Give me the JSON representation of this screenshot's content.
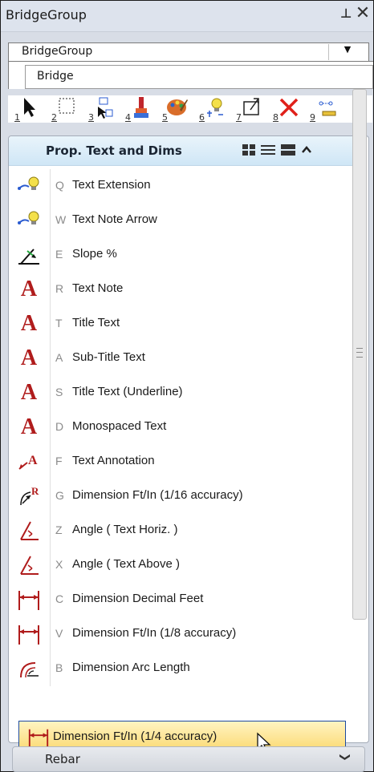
{
  "window": {
    "title": "BridgeGroup"
  },
  "group_select": {
    "value": "BridgeGroup"
  },
  "subtab": {
    "label": "Bridge"
  },
  "toolbar": {
    "tools": [
      {
        "num": "1",
        "icon": "select-arrow-icon"
      },
      {
        "num": "2",
        "icon": "selection-box-icon"
      },
      {
        "num": "3",
        "icon": "element-selection-icon"
      },
      {
        "num": "4",
        "icon": "paint-brush-icon"
      },
      {
        "num": "5",
        "icon": "palette-icon"
      },
      {
        "num": "6",
        "icon": "highlight-bulb-icon"
      },
      {
        "num": "7",
        "icon": "fit-view-icon"
      },
      {
        "num": "8",
        "icon": "delete-x-icon"
      },
      {
        "num": "9",
        "icon": "measure-icon"
      }
    ]
  },
  "panel": {
    "title": "Prop. Text and Dims",
    "items": [
      {
        "key": "Q",
        "label": "Text Extension",
        "icon": "bulb-arrow-icon"
      },
      {
        "key": "W",
        "label": "Text Note Arrow",
        "icon": "bulb-arrow-icon"
      },
      {
        "key": "E",
        "label": "Slope %",
        "icon": "slope-icon"
      },
      {
        "key": "R",
        "label": "Text Note",
        "icon": "letter-a-icon"
      },
      {
        "key": "T",
        "label": "Title Text",
        "icon": "letter-a-icon"
      },
      {
        "key": "A",
        "label": "Sub-Title Text",
        "icon": "letter-a-icon"
      },
      {
        "key": "S",
        "label": "Title Text (Underline)",
        "icon": "letter-a-icon"
      },
      {
        "key": "D",
        "label": "Monospaced Text",
        "icon": "letter-a-icon"
      },
      {
        "key": "F",
        "label": "Text Annotation",
        "icon": "annotation-icon"
      },
      {
        "key": "G",
        "label": "Dimension Ft/In (1/16 accuracy)",
        "icon": "radius-dim-icon"
      },
      {
        "key": "Z",
        "label": "Angle ( Text Horiz. )",
        "icon": "angle-icon"
      },
      {
        "key": "X",
        "label": "Angle ( Text Above )",
        "icon": "angle-icon"
      },
      {
        "key": "C",
        "label": "Dimension Decimal Feet",
        "icon": "linear-dim-icon"
      },
      {
        "key": "V",
        "label": "Dimension Ft/In (1/8 accuracy)",
        "icon": "linear-dim-icon"
      },
      {
        "key": "B",
        "label": "Dimension Arc Length",
        "icon": "arc-dim-icon"
      }
    ],
    "selected_item": {
      "label": "Dimension Ft/In (1/4 accuracy)",
      "icon": "linear-dim-icon"
    }
  },
  "rebar_section": {
    "label": "Rebar"
  },
  "colors": {
    "accent_red": "#b01c1c",
    "header_blue": "#cfe6f6",
    "selection": "#fbd76b"
  }
}
